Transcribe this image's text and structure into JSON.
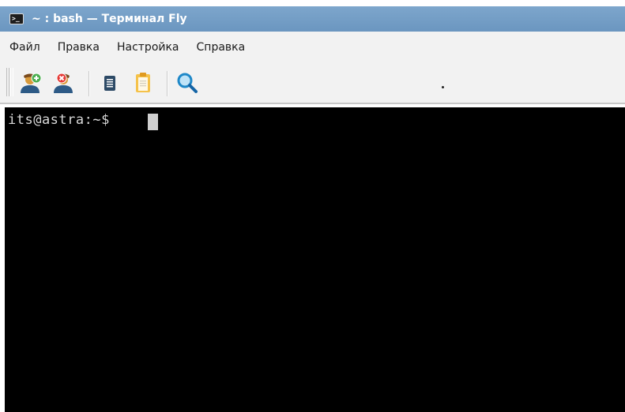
{
  "window": {
    "title": "~ : bash — Терминал Fly",
    "title_icon_text": ">_",
    "titlebar_color": "#7099c3"
  },
  "menu": {
    "items": [
      "Файл",
      "Правка",
      "Настройка",
      "Справка"
    ]
  },
  "toolbar": {
    "buttons": [
      {
        "icon": "new-session-icon",
        "tooltip": ""
      },
      {
        "icon": "close-session-icon",
        "tooltip": ""
      },
      {
        "icon": "copy-icon",
        "tooltip": ""
      },
      {
        "icon": "paste-icon",
        "tooltip": ""
      },
      {
        "icon": "search-icon",
        "tooltip": ""
      }
    ]
  },
  "terminal": {
    "prompt": "its@astra:~$ ",
    "background": "#000000",
    "foreground": "#d9d9d9"
  }
}
